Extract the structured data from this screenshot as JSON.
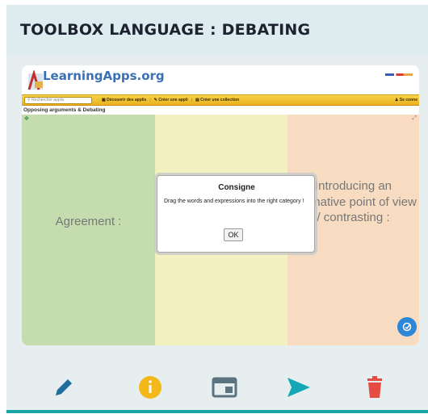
{
  "header": {
    "title": "TOOLBOX LANGUAGE : DEBATING"
  },
  "embed": {
    "site_logo": "LearningApps.org",
    "toolbar": {
      "search_placeholder": "Rechercher applis",
      "nav_discover": "Découvrir des applis",
      "nav_create_app": "Créer une appli",
      "nav_create_collection": "Créer une collection",
      "login": "Se conne"
    },
    "app_title": "Opposing arguments & Debating",
    "columns": [
      {
        "label": "Agreement :",
        "color": "#c5dcaf"
      },
      {
        "label": "",
        "color": "#f4f1c1"
      },
      {
        "label": "Introducing an alternative point of view / contrasting :",
        "color": "#f8dcc2"
      }
    ],
    "dialog": {
      "title": "Consigne",
      "text": "Drag the words and expressions into the right category !",
      "ok": "OK"
    }
  },
  "bottom_toolbar": {
    "icons": [
      "pencil-icon",
      "info-icon",
      "layout-icon",
      "send-icon",
      "trash-icon"
    ],
    "colors": {
      "pencil": "#1f6f9e",
      "info": "#f4b81a",
      "layout": "#5b7480",
      "send": "#12a8b6",
      "trash": "#e54b43"
    }
  }
}
